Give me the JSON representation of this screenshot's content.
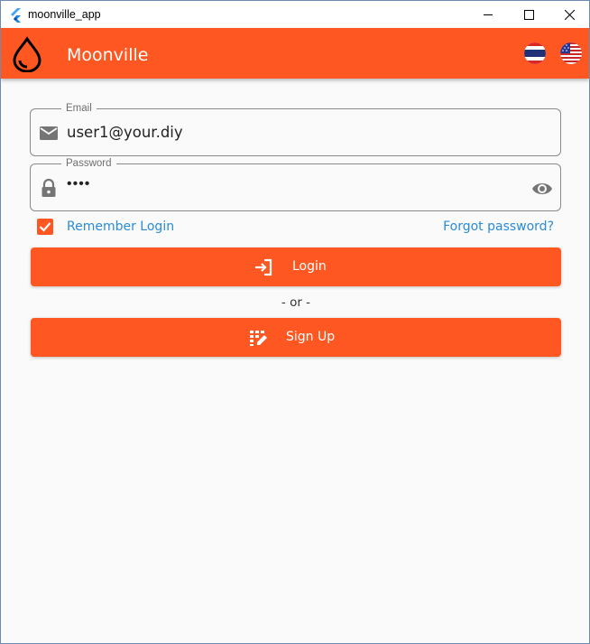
{
  "window": {
    "title": "moonville_app"
  },
  "appbar": {
    "title": "Moonville",
    "languages": [
      {
        "name": "Thai",
        "icon": "thai-flag-icon"
      },
      {
        "name": "English",
        "icon": "us-flag-icon"
      }
    ]
  },
  "form": {
    "email": {
      "label": "Email",
      "value": "user1@your.diy",
      "icon": "email-icon"
    },
    "password": {
      "label": "Password",
      "value": "••••",
      "icon": "lock-icon",
      "toggle_icon": "eye-icon"
    },
    "remember": {
      "label": "Remember Login",
      "checked": true
    },
    "forgot_label": "Forgot password?",
    "login_label": "Login",
    "or_label": "- or -",
    "signup_label": "Sign Up"
  },
  "colors": {
    "primary": "#ff5722",
    "link": "#2a8bd6",
    "background": "#fafafa"
  }
}
